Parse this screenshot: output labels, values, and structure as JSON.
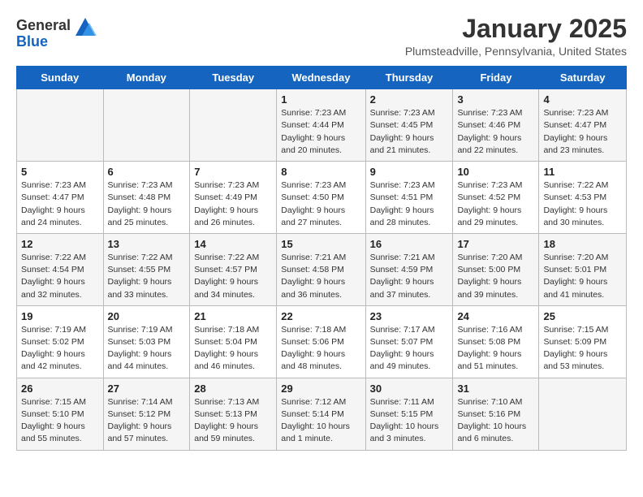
{
  "logo": {
    "general": "General",
    "blue": "Blue"
  },
  "header": {
    "month": "January 2025",
    "location": "Plumsteadville, Pennsylvania, United States"
  },
  "weekdays": [
    "Sunday",
    "Monday",
    "Tuesday",
    "Wednesday",
    "Thursday",
    "Friday",
    "Saturday"
  ],
  "weeks": [
    [
      {
        "day": "",
        "info": ""
      },
      {
        "day": "",
        "info": ""
      },
      {
        "day": "",
        "info": ""
      },
      {
        "day": "1",
        "info": "Sunrise: 7:23 AM\nSunset: 4:44 PM\nDaylight: 9 hours\nand 20 minutes."
      },
      {
        "day": "2",
        "info": "Sunrise: 7:23 AM\nSunset: 4:45 PM\nDaylight: 9 hours\nand 21 minutes."
      },
      {
        "day": "3",
        "info": "Sunrise: 7:23 AM\nSunset: 4:46 PM\nDaylight: 9 hours\nand 22 minutes."
      },
      {
        "day": "4",
        "info": "Sunrise: 7:23 AM\nSunset: 4:47 PM\nDaylight: 9 hours\nand 23 minutes."
      }
    ],
    [
      {
        "day": "5",
        "info": "Sunrise: 7:23 AM\nSunset: 4:47 PM\nDaylight: 9 hours\nand 24 minutes."
      },
      {
        "day": "6",
        "info": "Sunrise: 7:23 AM\nSunset: 4:48 PM\nDaylight: 9 hours\nand 25 minutes."
      },
      {
        "day": "7",
        "info": "Sunrise: 7:23 AM\nSunset: 4:49 PM\nDaylight: 9 hours\nand 26 minutes."
      },
      {
        "day": "8",
        "info": "Sunrise: 7:23 AM\nSunset: 4:50 PM\nDaylight: 9 hours\nand 27 minutes."
      },
      {
        "day": "9",
        "info": "Sunrise: 7:23 AM\nSunset: 4:51 PM\nDaylight: 9 hours\nand 28 minutes."
      },
      {
        "day": "10",
        "info": "Sunrise: 7:23 AM\nSunset: 4:52 PM\nDaylight: 9 hours\nand 29 minutes."
      },
      {
        "day": "11",
        "info": "Sunrise: 7:22 AM\nSunset: 4:53 PM\nDaylight: 9 hours\nand 30 minutes."
      }
    ],
    [
      {
        "day": "12",
        "info": "Sunrise: 7:22 AM\nSunset: 4:54 PM\nDaylight: 9 hours\nand 32 minutes."
      },
      {
        "day": "13",
        "info": "Sunrise: 7:22 AM\nSunset: 4:55 PM\nDaylight: 9 hours\nand 33 minutes."
      },
      {
        "day": "14",
        "info": "Sunrise: 7:22 AM\nSunset: 4:57 PM\nDaylight: 9 hours\nand 34 minutes."
      },
      {
        "day": "15",
        "info": "Sunrise: 7:21 AM\nSunset: 4:58 PM\nDaylight: 9 hours\nand 36 minutes."
      },
      {
        "day": "16",
        "info": "Sunrise: 7:21 AM\nSunset: 4:59 PM\nDaylight: 9 hours\nand 37 minutes."
      },
      {
        "day": "17",
        "info": "Sunrise: 7:20 AM\nSunset: 5:00 PM\nDaylight: 9 hours\nand 39 minutes."
      },
      {
        "day": "18",
        "info": "Sunrise: 7:20 AM\nSunset: 5:01 PM\nDaylight: 9 hours\nand 41 minutes."
      }
    ],
    [
      {
        "day": "19",
        "info": "Sunrise: 7:19 AM\nSunset: 5:02 PM\nDaylight: 9 hours\nand 42 minutes."
      },
      {
        "day": "20",
        "info": "Sunrise: 7:19 AM\nSunset: 5:03 PM\nDaylight: 9 hours\nand 44 minutes."
      },
      {
        "day": "21",
        "info": "Sunrise: 7:18 AM\nSunset: 5:04 PM\nDaylight: 9 hours\nand 46 minutes."
      },
      {
        "day": "22",
        "info": "Sunrise: 7:18 AM\nSunset: 5:06 PM\nDaylight: 9 hours\nand 48 minutes."
      },
      {
        "day": "23",
        "info": "Sunrise: 7:17 AM\nSunset: 5:07 PM\nDaylight: 9 hours\nand 49 minutes."
      },
      {
        "day": "24",
        "info": "Sunrise: 7:16 AM\nSunset: 5:08 PM\nDaylight: 9 hours\nand 51 minutes."
      },
      {
        "day": "25",
        "info": "Sunrise: 7:15 AM\nSunset: 5:09 PM\nDaylight: 9 hours\nand 53 minutes."
      }
    ],
    [
      {
        "day": "26",
        "info": "Sunrise: 7:15 AM\nSunset: 5:10 PM\nDaylight: 9 hours\nand 55 minutes."
      },
      {
        "day": "27",
        "info": "Sunrise: 7:14 AM\nSunset: 5:12 PM\nDaylight: 9 hours\nand 57 minutes."
      },
      {
        "day": "28",
        "info": "Sunrise: 7:13 AM\nSunset: 5:13 PM\nDaylight: 9 hours\nand 59 minutes."
      },
      {
        "day": "29",
        "info": "Sunrise: 7:12 AM\nSunset: 5:14 PM\nDaylight: 10 hours\nand 1 minute."
      },
      {
        "day": "30",
        "info": "Sunrise: 7:11 AM\nSunset: 5:15 PM\nDaylight: 10 hours\nand 3 minutes."
      },
      {
        "day": "31",
        "info": "Sunrise: 7:10 AM\nSunset: 5:16 PM\nDaylight: 10 hours\nand 6 minutes."
      },
      {
        "day": "",
        "info": ""
      }
    ]
  ]
}
